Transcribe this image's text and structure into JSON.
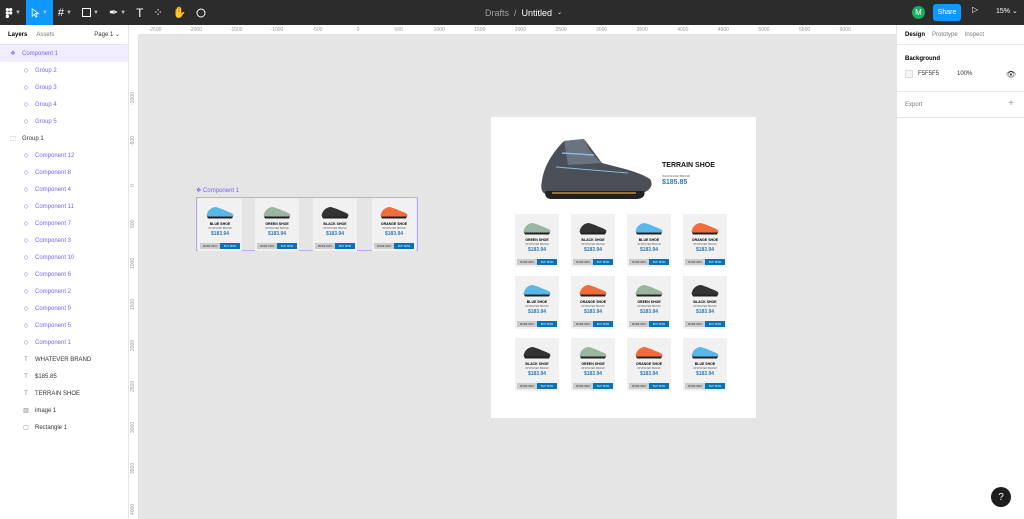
{
  "toolbar": {
    "breadcrumb": "Drafts",
    "separator": "/",
    "file_name": "Untitled",
    "avatar_initial": "M",
    "share_label": "Share",
    "zoom": "15%"
  },
  "left_panel": {
    "tabs": [
      "Layers",
      "Assets"
    ],
    "page": "Page 1",
    "layers": [
      {
        "label": "Component 1",
        "icon": "component-icon",
        "type": "component",
        "indent": 0,
        "selected": true
      },
      {
        "label": "Group 2",
        "icon": "instance-icon",
        "type": "component",
        "indent": 1
      },
      {
        "label": "Group 3",
        "icon": "instance-icon",
        "type": "component",
        "indent": 1
      },
      {
        "label": "Group 4",
        "icon": "instance-icon",
        "type": "component",
        "indent": 1
      },
      {
        "label": "Group 5",
        "icon": "instance-icon",
        "type": "component",
        "indent": 1
      },
      {
        "label": "Group 1",
        "icon": "frame-icon",
        "type": "plain",
        "indent": 0
      },
      {
        "label": "Component 12",
        "icon": "instance-icon",
        "type": "component",
        "indent": 1
      },
      {
        "label": "Component 8",
        "icon": "instance-icon",
        "type": "component",
        "indent": 1
      },
      {
        "label": "Component 4",
        "icon": "instance-icon",
        "type": "component",
        "indent": 1
      },
      {
        "label": "Component 11",
        "icon": "instance-icon",
        "type": "component",
        "indent": 1
      },
      {
        "label": "Component 7",
        "icon": "instance-icon",
        "type": "component",
        "indent": 1
      },
      {
        "label": "Component 3",
        "icon": "instance-icon",
        "type": "component",
        "indent": 1
      },
      {
        "label": "Component 10",
        "icon": "instance-icon",
        "type": "component",
        "indent": 1
      },
      {
        "label": "Component 6",
        "icon": "instance-icon",
        "type": "component",
        "indent": 1
      },
      {
        "label": "Component 2",
        "icon": "instance-icon",
        "type": "component",
        "indent": 1
      },
      {
        "label": "Component 9",
        "icon": "instance-icon",
        "type": "component",
        "indent": 1
      },
      {
        "label": "Component 5",
        "icon": "instance-icon",
        "type": "component",
        "indent": 1
      },
      {
        "label": "Component 1",
        "icon": "instance-icon",
        "type": "component",
        "indent": 1
      },
      {
        "label": "WHATEVER BRAND",
        "icon": "text-icon",
        "type": "plain",
        "indent": 1
      },
      {
        "label": "$185.85",
        "icon": "text-icon",
        "type": "plain",
        "indent": 1
      },
      {
        "label": "TERRAIN SHOE",
        "icon": "text-icon",
        "type": "plain",
        "indent": 1
      },
      {
        "label": "image 1",
        "icon": "image-icon",
        "type": "plain",
        "indent": 1
      },
      {
        "label": "Rectangle 1",
        "icon": "rectangle-icon",
        "type": "plain",
        "indent": 1
      }
    ]
  },
  "right_panel": {
    "tabs": [
      "Design",
      "Prototype",
      "Inspect"
    ],
    "background_heading": "Background",
    "background_hex": "F5F5F5",
    "background_opacity": "100%",
    "export_label": "Export"
  },
  "canvas": {
    "h_ticks": [
      "-2500",
      "-2000",
      "-1500",
      "-1000",
      "-500",
      "0",
      "500",
      "1000",
      "1500",
      "2000",
      "2500",
      "3000",
      "3500",
      "4000",
      "4500",
      "5000",
      "5500",
      "6000"
    ],
    "v_ticks": [
      "-1000",
      "-500",
      "0",
      "500",
      "1000",
      "1500",
      "2000",
      "2500",
      "3000",
      "3500",
      "4000"
    ],
    "component_label": "Component 1",
    "hero": {
      "name": "TERRAIN SHOE",
      "brand": "WHATEVER BRAND",
      "price": "$185.85"
    },
    "component_cells": [
      {
        "name": "BLUE SHOE",
        "brand": "WHATEVER BRAND",
        "price": "$183.94",
        "btn1": "MORE INFO",
        "btn2": "BUY NOW",
        "color": "#5ab8e8"
      },
      {
        "name": "GREEN SHOE",
        "brand": "WHATEVER BRAND",
        "price": "$183.94",
        "btn1": "MORE INFO",
        "btn2": "BUY NOW",
        "color": "#9bb5a0"
      },
      {
        "name": "BLACK SHOE",
        "brand": "WHATEVER BRAND",
        "price": "$183.94",
        "btn1": "MORE INFO",
        "btn2": "BUY NOW",
        "color": "#333333"
      },
      {
        "name": "ORANGE SHOE",
        "brand": "WHATEVER BRAND",
        "price": "$183.94",
        "btn1": "MORE INFO",
        "btn2": "BUY NOW",
        "color": "#f26b3a"
      }
    ],
    "grid_cards": [
      {
        "name": "GREEN SHOE",
        "brand": "WHATEVER BRAND",
        "price": "$183.94",
        "btn1": "MORE INFO",
        "btn2": "BUY NOW",
        "color": "#9bb5a0"
      },
      {
        "name": "BLACK SHOE",
        "brand": "WHATEVER BRAND",
        "price": "$183.94",
        "btn1": "MORE INFO",
        "btn2": "BUY NOW",
        "color": "#333333"
      },
      {
        "name": "BLUE SHOE",
        "brand": "WHATEVER BRAND",
        "price": "$183.94",
        "btn1": "MORE INFO",
        "btn2": "BUY NOW",
        "color": "#5ab8e8"
      },
      {
        "name": "ORANGE SHOE",
        "brand": "WHATEVER BRAND",
        "price": "$183.94",
        "btn1": "MORE INFO",
        "btn2": "BUY NOW",
        "color": "#f26b3a"
      },
      {
        "name": "BLUE SHOE",
        "brand": "WHATEVER BRAND",
        "price": "$183.94",
        "btn1": "MORE INFO",
        "btn2": "BUY NOW",
        "color": "#5ab8e8"
      },
      {
        "name": "ORANGE SHOE",
        "brand": "WHATEVER BRAND",
        "price": "$183.94",
        "btn1": "MORE INFO",
        "btn2": "BUY NOW",
        "color": "#f26b3a"
      },
      {
        "name": "GREEN SHOE",
        "brand": "WHATEVER BRAND",
        "price": "$183.94",
        "btn1": "MORE INFO",
        "btn2": "BUY NOW",
        "color": "#9bb5a0"
      },
      {
        "name": "BLACK SHOE",
        "brand": "WHATEVER BRAND",
        "price": "$183.94",
        "btn1": "MORE INFO",
        "btn2": "BUY NOW",
        "color": "#333333"
      },
      {
        "name": "BLACK SHOE",
        "brand": "WHATEVER BRAND",
        "price": "$183.94",
        "btn1": "MORE INFO",
        "btn2": "BUY NOW",
        "color": "#333333"
      },
      {
        "name": "GREEN SHOE",
        "brand": "WHATEVER BRAND",
        "price": "$183.94",
        "btn1": "MORE INFO",
        "btn2": "BUY NOW",
        "color": "#9bb5a0"
      },
      {
        "name": "ORANGE SHOE",
        "brand": "WHATEVER BRAND",
        "price": "$183.94",
        "btn1": "MORE INFO",
        "btn2": "BUY NOW",
        "color": "#f26b3a"
      },
      {
        "name": "BLUE SHOE",
        "brand": "WHATEVER BRAND",
        "price": "$183.94",
        "btn1": "MORE INFO",
        "btn2": "BUY NOW",
        "color": "#5ab8e8"
      }
    ]
  },
  "help_label": "?"
}
